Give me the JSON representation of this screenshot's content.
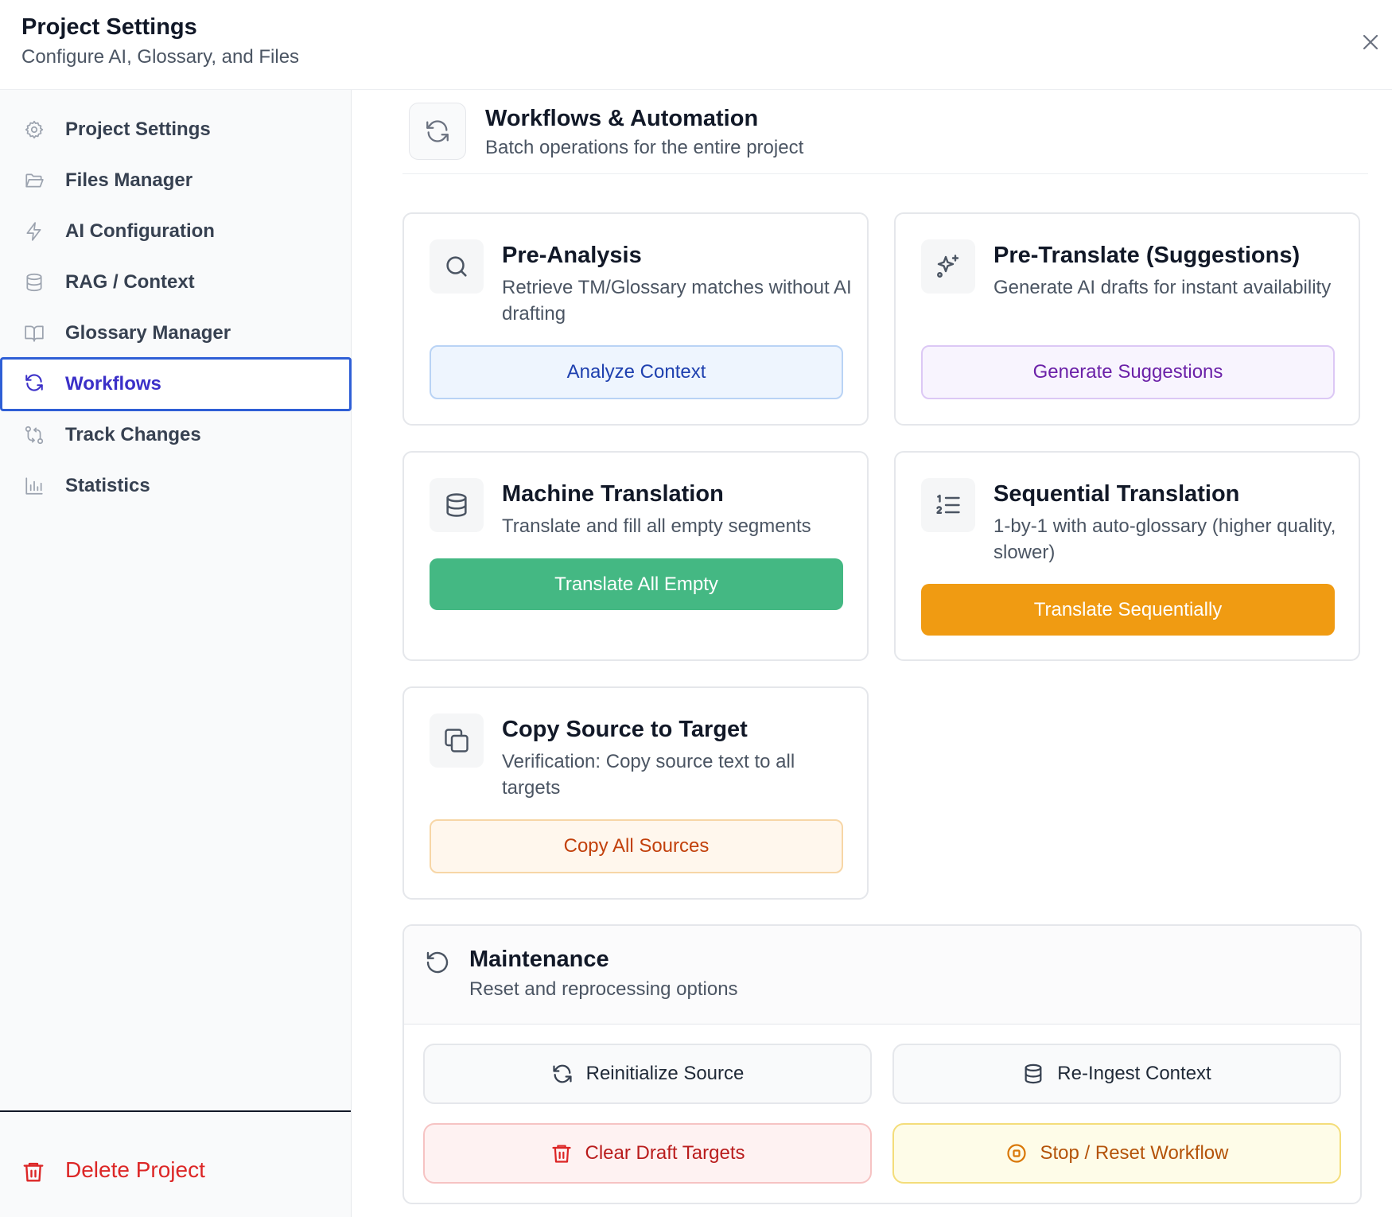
{
  "header": {
    "title": "Project Settings",
    "subtitle": "Configure AI, Glossary, and Files"
  },
  "sidebar": {
    "items": [
      {
        "label": "Project Settings",
        "icon": "gear-icon"
      },
      {
        "label": "Files Manager",
        "icon": "folder-open-icon"
      },
      {
        "label": "AI Configuration",
        "icon": "lightning-icon"
      },
      {
        "label": "RAG / Context",
        "icon": "database-icon"
      },
      {
        "label": "Glossary Manager",
        "icon": "book-open-icon"
      },
      {
        "label": "Workflows",
        "icon": "refresh-icon",
        "active": true
      },
      {
        "label": "Track Changes",
        "icon": "git-compare-icon"
      },
      {
        "label": "Statistics",
        "icon": "bar-chart-icon"
      }
    ],
    "delete_label": "Delete Project"
  },
  "section": {
    "title": "Workflows & Automation",
    "subtitle": "Batch operations for the entire project"
  },
  "cards": {
    "pre_analysis": {
      "title": "Pre-Analysis",
      "desc": "Retrieve TM/Glossary matches without AI drafting",
      "button": "Analyze Context"
    },
    "pre_translate": {
      "title": "Pre-Translate (Suggestions)",
      "desc": "Generate AI drafts for instant availability",
      "button": "Generate Suggestions"
    },
    "machine_translation": {
      "title": "Machine Translation",
      "desc": "Translate and fill all empty segments",
      "button": "Translate All Empty"
    },
    "sequential_translation": {
      "title": "Sequential Translation",
      "desc": "1-by-1 with auto-glossary (higher quality, slower)",
      "button": "Translate Sequentially"
    },
    "copy_source": {
      "title": "Copy Source to Target",
      "desc": "Verification: Copy source text to all targets",
      "button": "Copy All Sources"
    }
  },
  "maintenance": {
    "title": "Maintenance",
    "subtitle": "Reset and reprocessing options",
    "buttons": {
      "reinitialize": "Reinitialize Source",
      "reingest": "Re-Ingest Context",
      "clear_drafts": "Clear Draft Targets",
      "stop_reset": "Stop / Reset Workflow"
    }
  },
  "colors": {
    "accent": "#3b30c8",
    "active_border": "#2f5fd6",
    "green": "#44b883",
    "orange": "#f09b12",
    "danger": "#dc2626"
  }
}
